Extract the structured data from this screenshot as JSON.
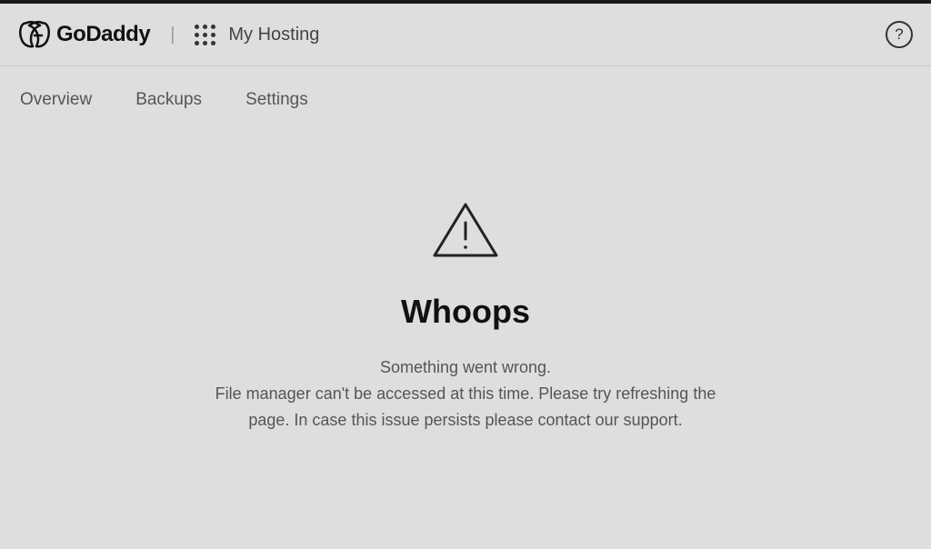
{
  "brand": {
    "name": "GoDaddy"
  },
  "header": {
    "app_name": "My Hosting",
    "help_symbol": "?"
  },
  "tabs": [
    {
      "label": "Overview"
    },
    {
      "label": "Backups"
    },
    {
      "label": "Settings"
    }
  ],
  "error": {
    "title": "Whoops",
    "line1": "Something went wrong.",
    "line2": "File manager can't be accessed at this time. Please try refreshing the",
    "line3": "page. In case this issue persists please contact our support."
  }
}
